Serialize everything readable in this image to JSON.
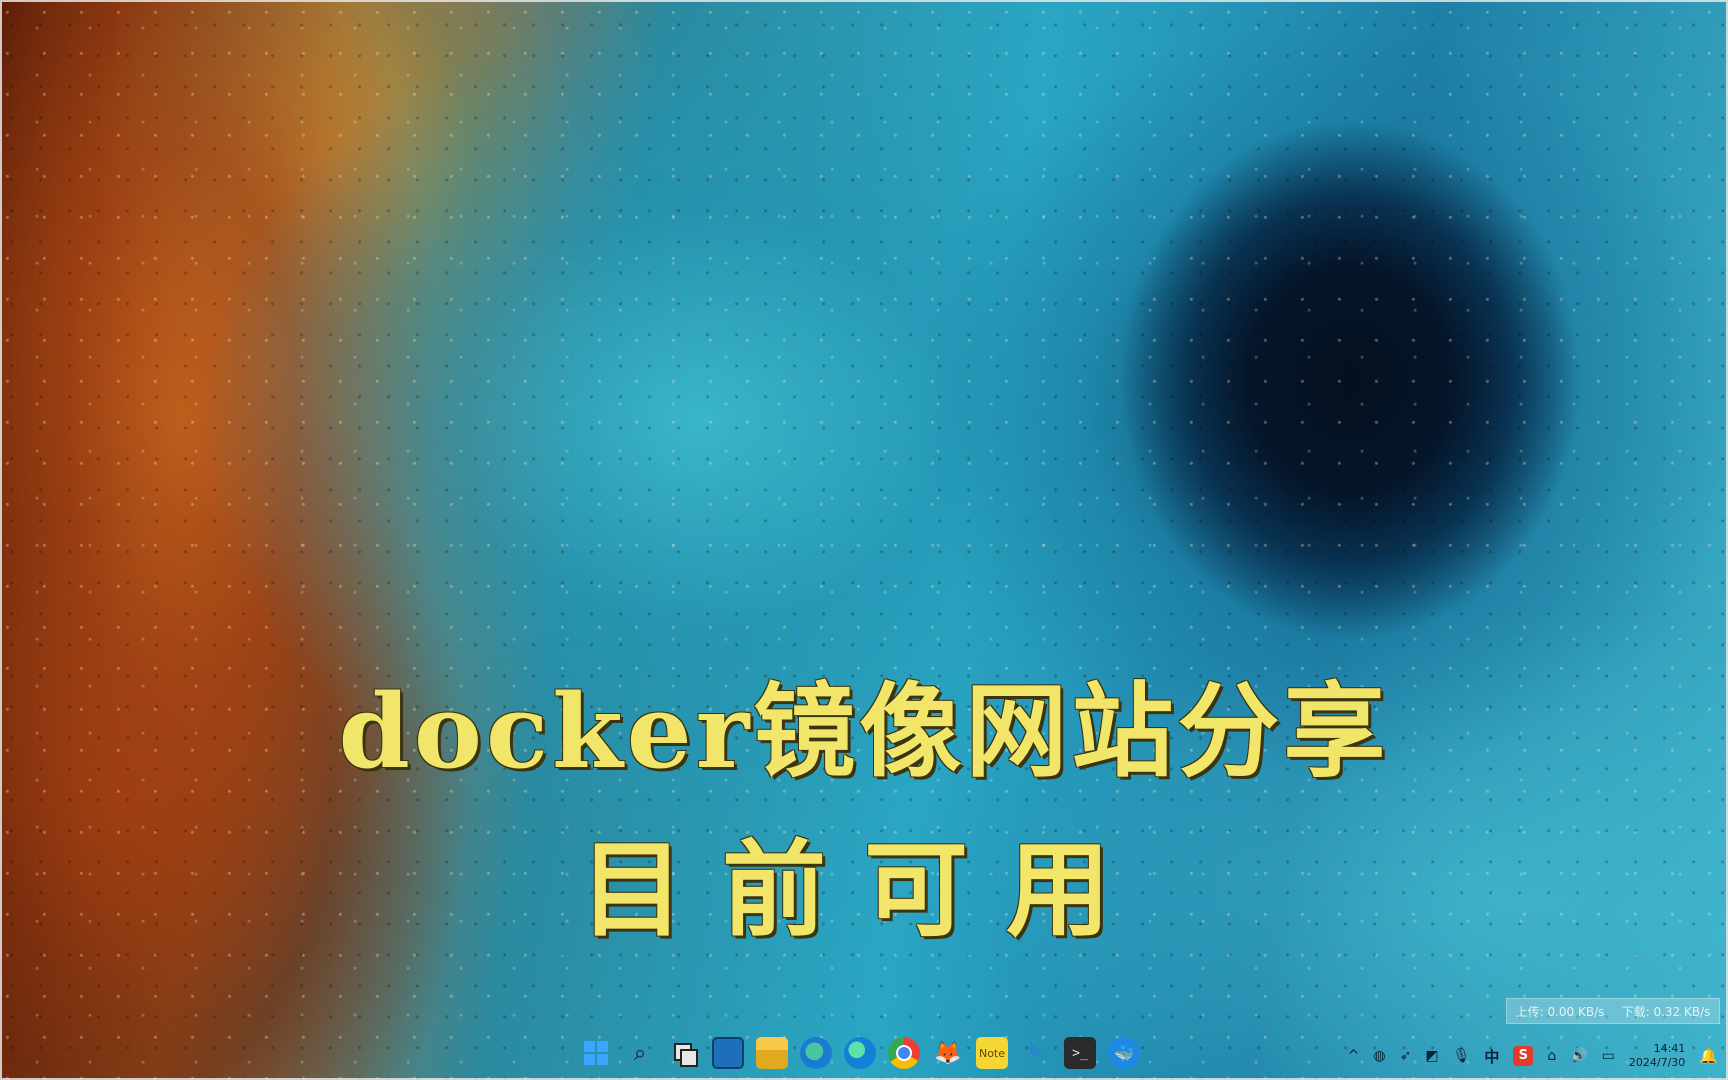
{
  "title_overlay": {
    "line1": "docker镜像网站分享",
    "line2": "目前可用"
  },
  "net_speed": {
    "upload": "上传: 0.00 KB/s",
    "download": "下载: 0.32 KB/s"
  },
  "taskbar": {
    "pinned_icons": [
      "windows-start-icon",
      "search-icon",
      "task-view-icon",
      "widgets-icon",
      "file-explorer-icon",
      "edge-dev-icon",
      "edge-icon",
      "chrome-icon",
      "fox-app-icon",
      "sticky-notes-icon",
      "pen-tool-icon",
      "terminal-icon",
      "docker-whale-icon"
    ],
    "note_label": "Note",
    "term_glyph": ">_",
    "ime": "中",
    "sogou": "S",
    "time": "14:41",
    "date": "2024/7/30"
  }
}
